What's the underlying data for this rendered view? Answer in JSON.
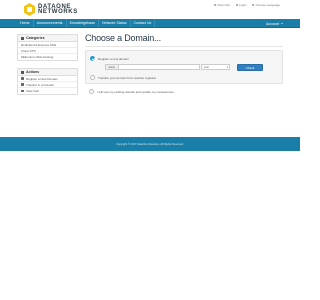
{
  "brand": {
    "line1": "DATAONE",
    "line2": "NETWORKS",
    "color": "#f0c419"
  },
  "toplinks": [
    "View Cart",
    "Login",
    "Choose Language"
  ],
  "nav": {
    "items": [
      "Home",
      "Announcements",
      "Knowledgebase",
      "Network Status",
      "Contact Us"
    ],
    "account": "Account"
  },
  "sidebar": {
    "categories": {
      "title": "Categories",
      "items": [
        "Dedicated & Express SSH",
        "Cloud VPS",
        "Millennium Web Hosting"
      ]
    },
    "actions": {
      "title": "Actions",
      "items": [
        {
          "label": "Register a New Domain",
          "icon": "globe-icon"
        },
        {
          "label": "Transfer in a Domain",
          "icon": "transfer-icon"
        },
        {
          "label": "View Cart",
          "icon": "cart-icon"
        }
      ]
    }
  },
  "main": {
    "title": "Choose a Domain...",
    "options": [
      "Register a new domain",
      "Transfer your domain from another registrar",
      "I will use my existing domain and update my nameservers"
    ],
    "www_prefix": "www.",
    "tld_value": ".com",
    "check_button": "Check"
  },
  "footer": {
    "copyright": "Copyright © 2017 DataOne Networks. All Rights Reserved."
  },
  "colors": {
    "nav": "#1a7fa8",
    "button": "#2f7fc1",
    "radio": "#1a9ad6"
  }
}
